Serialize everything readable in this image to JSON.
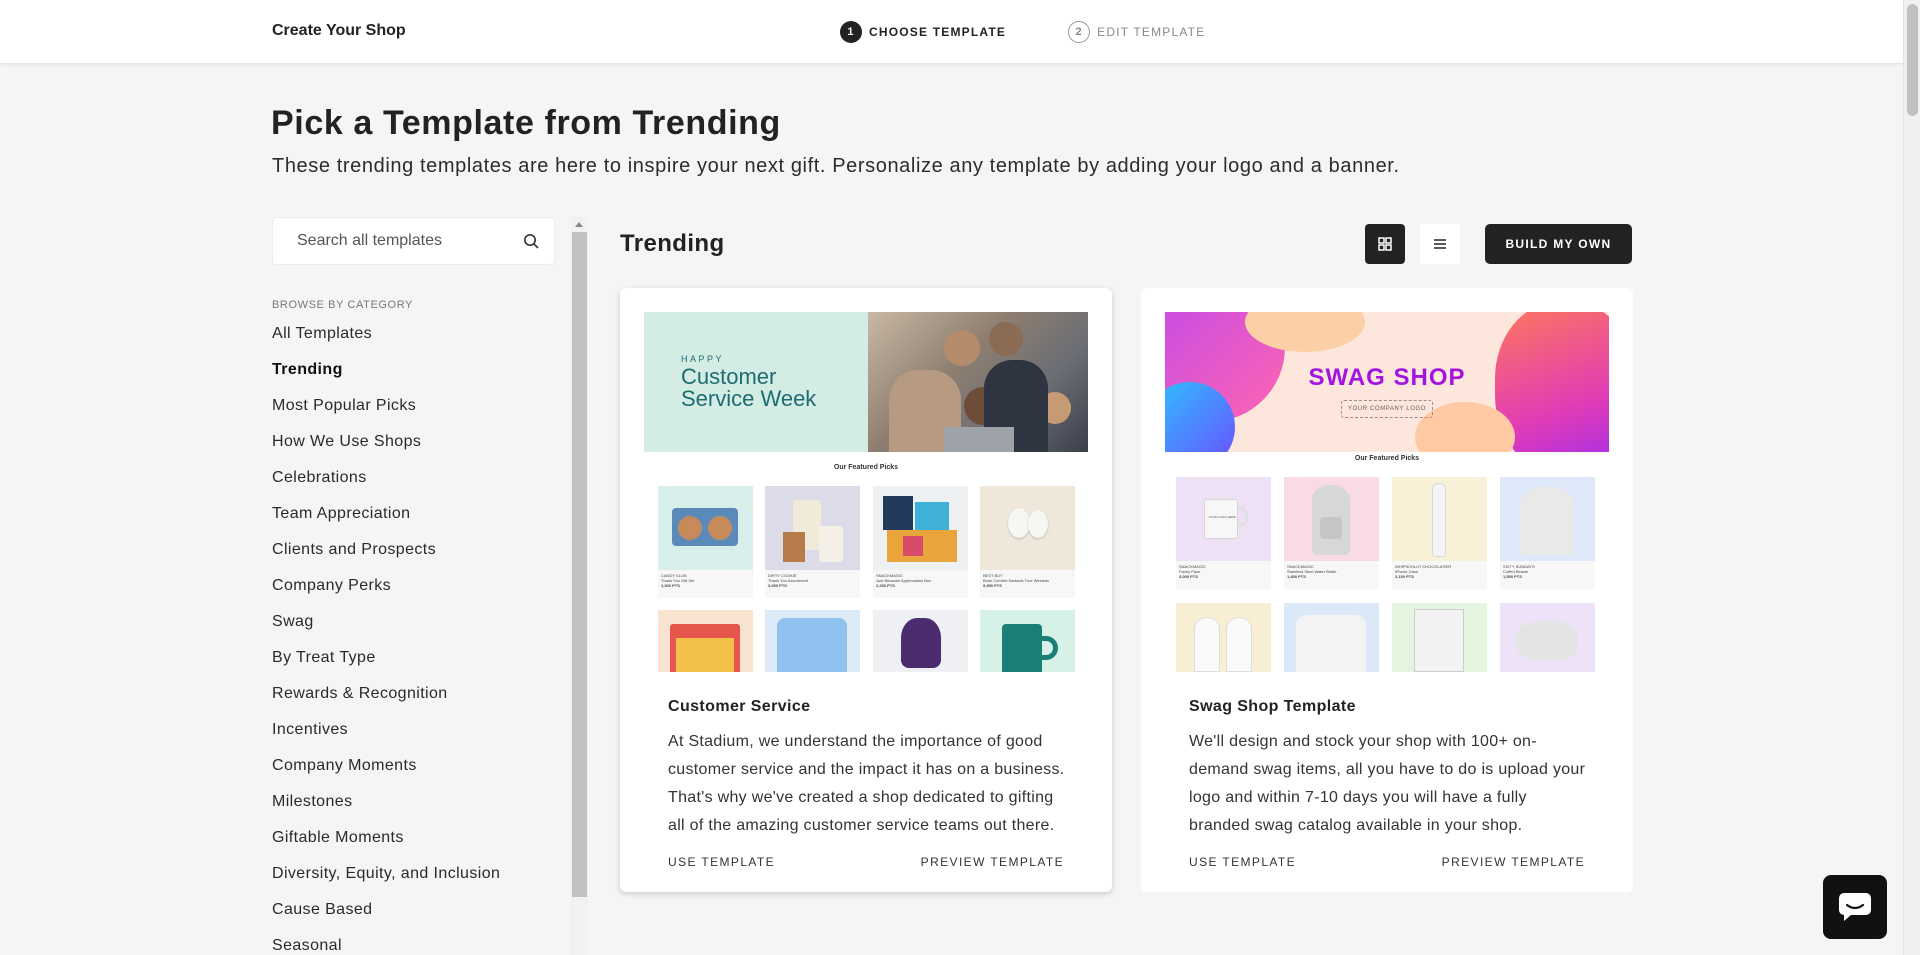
{
  "header": {
    "brand": "Create Your Shop",
    "steps": [
      {
        "num": "1",
        "label": "CHOOSE TEMPLATE"
      },
      {
        "num": "2",
        "label": "EDIT TEMPLATE"
      }
    ]
  },
  "page": {
    "title": "Pick a Template from Trending",
    "subtitle": "These trending templates are here to inspire your next gift. Personalize any template by adding your logo and a banner."
  },
  "sidebar": {
    "search_placeholder": "Search all templates",
    "category_heading": "BROWSE BY CATEGORY",
    "categories": [
      "All Templates",
      "Trending",
      "Most Popular Picks",
      "How We Use Shops",
      "Celebrations",
      "Team Appreciation",
      "Clients and Prospects",
      "Company Perks",
      "Swag",
      "By Treat Type",
      "Rewards & Recognition",
      "Incentives",
      "Company Moments",
      "Milestones",
      "Giftable Moments",
      "Diversity, Equity, and Inclusion",
      "Cause Based",
      "Seasonal"
    ],
    "active_category": "Trending"
  },
  "main": {
    "section_title": "Trending",
    "build_button": "BUILD MY OWN",
    "cards": [
      {
        "title": "Customer Service",
        "description": "At Stadium, we understand the importance of good customer service and the impact it has on a business. That's why we've created a shop dedicated to gifting all of the amazing customer service teams out there.",
        "use_label": "USE TEMPLATE",
        "preview_label": "PREVIEW TEMPLATE",
        "banner_small": "HAPPY",
        "banner_line1": "Customer",
        "banner_line2": "Service Week",
        "picks_label": "Our Featured Picks",
        "tiles": [
          {
            "brand": "CANDY CLUB",
            "name": "Thank You Gift Set",
            "pts": "1,300 PTS"
          },
          {
            "brand": "DIRTY COOKIE",
            "name": "Thank You Assortment",
            "pts": "3,050 PTS"
          },
          {
            "brand": "SNACKMAGIC",
            "name": "Just Because Appreciation Box",
            "pts": "2,250 PTS"
          },
          {
            "brand": "BEST BUY",
            "name": "Bose Comfort Earbuds True Wireless",
            "pts": "9,950 PTS"
          }
        ]
      },
      {
        "title": "Swag Shop Template",
        "description": "We'll design and stock your shop with 100+ on-demand swag items, all you have to do is upload your logo and within 7-10 days you will have a fully branded swag catalog available in your shop.",
        "use_label": "USE TEMPLATE",
        "preview_label": "PREVIEW TEMPLATE",
        "banner_title": "SWAG SHOP",
        "banner_logo": "YOUR COMPANY LOGO",
        "picks_label": "Our Featured Picks",
        "tile_logo": "YOUR LOGO HERE",
        "tiles": [
          {
            "brand": "SNACKMAGIC",
            "name": "Fanny Pack",
            "pts": "3,000 PTS"
          },
          {
            "brand": "SNACKMAGIC",
            "name": "Stainless Steel Water Bottle",
            "pts": "1,450 PTS"
          },
          {
            "brand": "WHIPSCHLUT CHOCOLATIER",
            "name": "iPhone Case",
            "pts": "2,150 PTS"
          },
          {
            "brand": "SIXTY SUNDAYS",
            "name": "Cuffed Beanie",
            "pts": "1,550 PTS"
          }
        ]
      }
    ]
  },
  "colors": {
    "accent": "#222222",
    "background": "#f5f5f4",
    "banner_mint": "#d3ece4",
    "banner_text": "#1f6b73",
    "swag_purple": "#a414e0"
  }
}
